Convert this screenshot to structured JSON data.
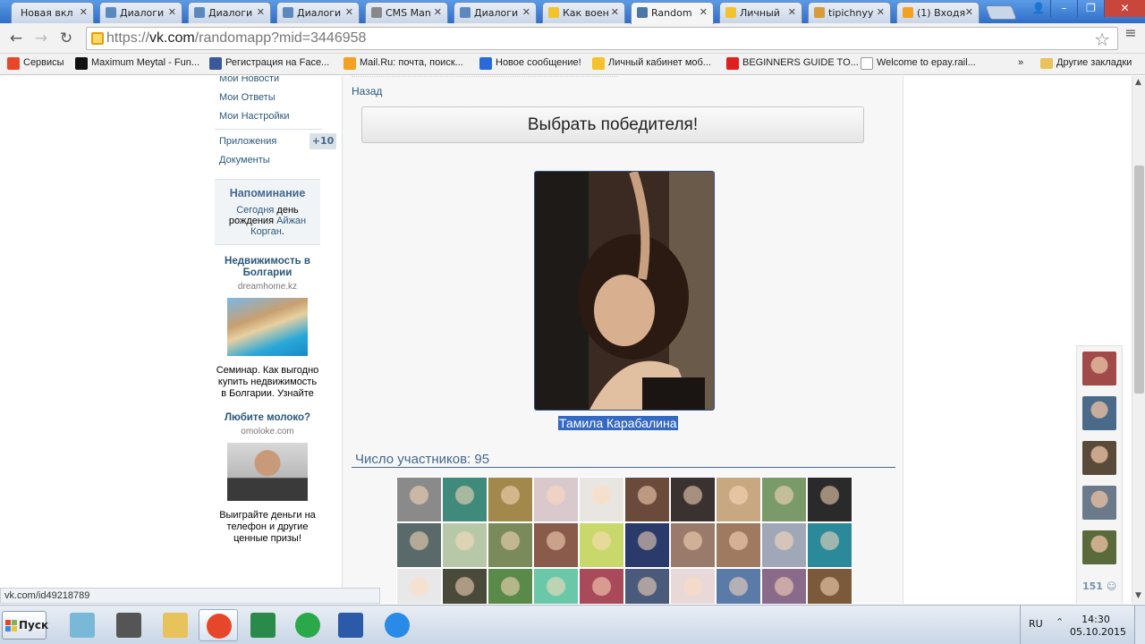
{
  "browser": {
    "tabs": [
      {
        "label": "Новая вкла",
        "icon": "blank-page-icon",
        "active": false
      },
      {
        "label": "Диалоги",
        "icon": "vk-dialog-icon",
        "active": false
      },
      {
        "label": "Диалоги",
        "icon": "vk-dialog-icon",
        "active": false
      },
      {
        "label": "Диалоги",
        "icon": "vk-dialog-icon",
        "active": false
      },
      {
        "label": "CMS Man",
        "icon": "cms-icon",
        "active": false
      },
      {
        "label": "Диалоги",
        "icon": "vk-dialog-icon",
        "active": false
      },
      {
        "label": "Как воен",
        "icon": "sun-icon",
        "active": false
      },
      {
        "label": "Random",
        "icon": "vk-logo-icon",
        "active": true
      },
      {
        "label": "Личный",
        "icon": "beeline-icon",
        "active": false
      },
      {
        "label": "tipichnyy",
        "icon": "pyramid-icon",
        "active": false
      },
      {
        "label": "(1) Входя",
        "icon": "mail-at-icon",
        "active": false
      }
    ],
    "url_prefix": "https://",
    "url_host": "vk.com",
    "url_path": "/randomapp?mid=3446958",
    "bookmarks": [
      {
        "label": "Сервисы",
        "icon": "apps-grid-icon"
      },
      {
        "label": "Maximum Meytal - Fun...",
        "icon": "m-logo-icon"
      },
      {
        "label": "Регистрация на Face...",
        "icon": "facebook-icon"
      },
      {
        "label": "Mail.Ru: почта, поиск...",
        "icon": "mailru-icon"
      },
      {
        "label": "Новое сообщение!",
        "icon": "flag-icon"
      },
      {
        "label": "Личный кабинет моб...",
        "icon": "beeline-icon"
      },
      {
        "label": "BEGINNERS GUIDE TO...",
        "icon": "youtube-icon"
      },
      {
        "label": "Welcome to epay.rail...",
        "icon": "page-icon"
      }
    ],
    "more": "»",
    "other_bookmarks": "Другие закладки"
  },
  "sidebar": {
    "items": [
      "Мои Новости",
      "Мои Ответы",
      "Мои Настройки"
    ],
    "apps_label": "Приложения",
    "apps_badge": "+10",
    "docs_label": "Документы",
    "reminder_title": "Напоминание",
    "reminder_today": "Сегодня",
    "reminder_text": " день рождения ",
    "reminder_name": "Айжан Корган",
    "reminder_dot": "."
  },
  "ads": [
    {
      "title": "Недвижимость в Болгарии",
      "domain": "dreamhome.kz",
      "text": "Семинар. Как выгодно купить недвижимость в Болгарии. Узнайте"
    },
    {
      "title": "Любите молоко?",
      "domain": "omoloke.com",
      "text": "Выиграйте деньги на телефон и другие ценные призы!"
    }
  ],
  "main": {
    "back": "Назад",
    "pick_button": "Выбрать победителя!",
    "winner_name": "Тамила Карабалина",
    "participants_label": "Число участников: 95",
    "avatar_colors": [
      "#8a8a8a",
      "#3f8a7a",
      "#a2884a",
      "#d9c8cc",
      "#e9e6e2",
      "#6a4a3a",
      "#3a3230",
      "#c8a880",
      "#7a9a6a",
      "#2a2a2a",
      "#5a6a6a",
      "#b7c8a8",
      "#7a8a5a",
      "#8a5a4a",
      "#c8d86a",
      "#2a3a6a",
      "#9a7a6a",
      "#a07a60",
      "#a0a8b8",
      "#2a8a9a",
      "#e8e8e8",
      "#4a4a3a",
      "#5a8a4a",
      "#6ac8a8",
      "#a84a5a",
      "#4a5a7a",
      "#e8d8d8",
      "#5a7aa8",
      "#8a6a8a",
      "#7a5a3a"
    ]
  },
  "friends": {
    "count": "151",
    "avatar_colors": [
      "#a04a4a",
      "#4a6a8a",
      "#5a4a3a",
      "#6a7a8a",
      "#5a6a3a"
    ]
  },
  "status_bar": "vk.com/id49218789",
  "taskbar": {
    "start": "Пуск",
    "apps": [
      "notepad-icon",
      "scanner-icon",
      "folder-icon",
      "chrome-icon",
      "excel-icon",
      "mailagent-icon",
      "word-icon",
      "ie-icon"
    ],
    "lang": "RU",
    "time": "14:30",
    "date": "05.10.2015"
  }
}
